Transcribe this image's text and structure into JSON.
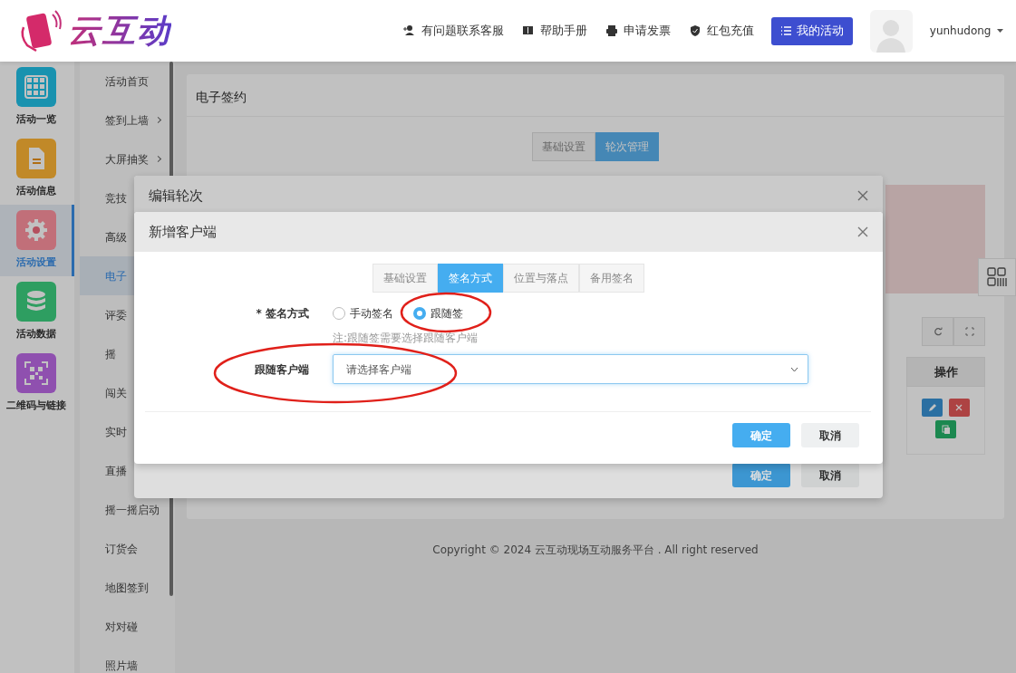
{
  "header": {
    "logo_text": "云互动",
    "links": [
      {
        "label": "有问题联系客服"
      },
      {
        "label": "帮助手册"
      },
      {
        "label": "申请发票"
      },
      {
        "label": "红包充值"
      }
    ],
    "my_activity": "我的活动",
    "username": "yunhudong"
  },
  "rail": {
    "items": [
      {
        "label": "活动一览",
        "color": "#1a93b0",
        "selected": false
      },
      {
        "label": "活动信息",
        "color": "#c98a2a",
        "selected": false
      },
      {
        "label": "活动设置",
        "color": "#c9707a",
        "selected": true
      },
      {
        "label": "活动数据",
        "color": "#2e9f62",
        "selected": false
      },
      {
        "label": "二维码与链接",
        "color": "#9050b0",
        "selected": false
      }
    ]
  },
  "submenu": {
    "items": [
      {
        "label": "活动首页",
        "selected": false,
        "expandable": false
      },
      {
        "label": "签到上墙",
        "selected": false,
        "expandable": true
      },
      {
        "label": "大屏抽奖",
        "selected": false,
        "expandable": true
      },
      {
        "label": "竞技",
        "selected": false,
        "expandable": false
      },
      {
        "label": "高级",
        "selected": false,
        "expandable": false
      },
      {
        "label": "电子",
        "selected": true,
        "expandable": false
      },
      {
        "label": "评委",
        "selected": false,
        "expandable": false
      },
      {
        "label": "摇",
        "selected": false,
        "expandable": false
      },
      {
        "label": "闯关",
        "selected": false,
        "expandable": false
      },
      {
        "label": "实时",
        "selected": false,
        "expandable": false
      },
      {
        "label": "直播",
        "selected": false,
        "expandable": false
      },
      {
        "label": "摇一摇启动",
        "selected": false,
        "expandable": false
      },
      {
        "label": "订货会",
        "selected": false,
        "expandable": false
      },
      {
        "label": "地图签到",
        "selected": false,
        "expandable": false
      },
      {
        "label": "对对碰",
        "selected": false,
        "expandable": false
      },
      {
        "label": "照片墙",
        "selected": false,
        "expandable": false
      }
    ]
  },
  "content": {
    "title": "电子签约",
    "tabs": [
      {
        "label": "基础设置",
        "selected": false
      },
      {
        "label": "轮次管理",
        "selected": true
      }
    ],
    "table": {
      "columns": [
        "操作"
      ]
    }
  },
  "footer": "Copyright © 2024 云互动现场互动服务平台 . All right reserved",
  "back_modal": {
    "title": "编辑轮次",
    "buttons": [
      {
        "label": "确定",
        "kind": "primary"
      },
      {
        "label": "取消",
        "kind": "secondary"
      }
    ]
  },
  "front_modal": {
    "title": "新增客户端",
    "tabs": [
      {
        "label": "基础设置",
        "selected": false
      },
      {
        "label": "签名方式",
        "selected": true
      },
      {
        "label": "位置与落点",
        "selected": false
      },
      {
        "label": "备用签名",
        "selected": false
      }
    ],
    "sign_method": {
      "label": "* 签名方式",
      "options": [
        {
          "label": "手动签名",
          "selected": false
        },
        {
          "label": "跟随签",
          "selected": true
        }
      ],
      "note": "注:跟随签需要选择跟随客户端"
    },
    "client": {
      "label": "跟随客户端",
      "placeholder": "请选择客户端"
    },
    "buttons": [
      {
        "label": "确定",
        "kind": "primary"
      },
      {
        "label": "取消",
        "kind": "secondary"
      }
    ]
  }
}
